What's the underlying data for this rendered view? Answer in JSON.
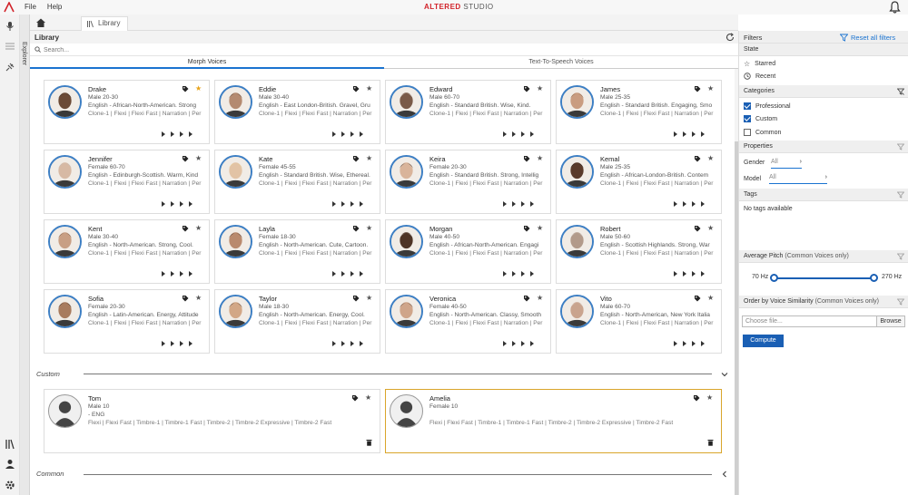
{
  "menu": {
    "file": "File",
    "help": "Help"
  },
  "brand": {
    "part1": "ALTERED",
    "part2": "STUDIO"
  },
  "explorer_label": "Explorer",
  "tabs": {
    "library": "Library"
  },
  "library": {
    "title": "Library",
    "search_placeholder": "Search...",
    "mode_tabs": [
      "Morph Voices",
      "Text-To-Speech Voices"
    ],
    "voices": [
      {
        "name": "Drake",
        "demo": "Male 20-30",
        "desc": "English - African-North-American. Strong",
        "types": "Clone-1 | Flexi | Flexi Fast | Narration | Per",
        "starred": true
      },
      {
        "name": "Eddie",
        "demo": "Male 30-40",
        "desc": "English - East London-British. Gravel, Gru",
        "types": "Clone-1 | Flexi | Flexi Fast | Narration | Per",
        "starred": false
      },
      {
        "name": "Edward",
        "demo": "Male 60-70",
        "desc": "English - Standard British. Wise, Kind.",
        "types": "Clone-1 | Flexi | Flexi Fast | Narration | Per",
        "starred": false
      },
      {
        "name": "James",
        "demo": "Male 25-35",
        "desc": "English - Standard British. Engaging, Smo",
        "types": "Clone-1 | Flexi | Flexi Fast | Narration | Per",
        "starred": false
      },
      {
        "name": "Jennifer",
        "demo": "Female 60-70",
        "desc": "English - Edinburgh-Scottish. Warm, Kind",
        "types": "Clone-1 | Flexi | Flexi Fast | Narration | Per",
        "starred": false
      },
      {
        "name": "Kate",
        "demo": "Female 45-55",
        "desc": "English - Standard British. Wise, Ethereal.",
        "types": "Clone-1 | Flexi | Flexi Fast | Narration | Per",
        "starred": false
      },
      {
        "name": "Keira",
        "demo": "Female 20-30",
        "desc": "English - Standard British. Strong, Intellig",
        "types": "Clone-1 | Flexi | Flexi Fast | Narration | Per",
        "starred": false
      },
      {
        "name": "Kemal",
        "demo": "Male 25-35",
        "desc": "English - African-London-British. Contem",
        "types": "Clone-1 | Flexi | Flexi Fast | Narration | Per",
        "starred": false
      },
      {
        "name": "Kent",
        "demo": "Male 30-40",
        "desc": "English - North-American. Strong, Cool.",
        "types": "Clone-1 | Flexi | Flexi Fast | Narration | Per",
        "starred": false
      },
      {
        "name": "Layla",
        "demo": "Female 18-30",
        "desc": "English - North-American. Cute, Cartoon.",
        "types": "Clone-1 | Flexi | Flexi Fast | Narration | Per",
        "starred": false
      },
      {
        "name": "Morgan",
        "demo": "Male 40-50",
        "desc": "English - African-North-American. Engagi",
        "types": "Clone-1 | Flexi | Flexi Fast | Narration | Per",
        "starred": false
      },
      {
        "name": "Robert",
        "demo": "Male 50-60",
        "desc": "English - Scottish Highlands. Strong, War",
        "types": "Clone-1 | Flexi | Flexi Fast | Narration | Per",
        "starred": false
      },
      {
        "name": "Sofia",
        "demo": "Female 20-30",
        "desc": "English - Latin-American. Energy, Attitude",
        "types": "Clone-1 | Flexi | Flexi Fast | Narration | Per",
        "starred": false
      },
      {
        "name": "Taylor",
        "demo": "Male 18-30",
        "desc": "English - North-American. Energy, Cool.",
        "types": "Clone-1 | Flexi | Flexi Fast | Narration | Per",
        "starred": false
      },
      {
        "name": "Veronica",
        "demo": "Female 40-50",
        "desc": "English - North-American. Classy, Smooth",
        "types": "Clone-1 | Flexi | Flexi Fast | Narration | Per",
        "starred": false
      },
      {
        "name": "Vito",
        "demo": "Male 60-70",
        "desc": "English - North-American, New York Italia",
        "types": "Clone-1 | Flexi | Flexi Fast | Narration | Per",
        "starred": false
      }
    ],
    "custom_section": "Custom",
    "custom_voices": [
      {
        "name": "Tom",
        "demo": "Male 10",
        "lang": "- ENG",
        "types": "Flexi | Flexi Fast | Timbre-1 | Timbre-1 Fast | Timbre-2 | Timbre-2 Expressive | Timbre-2 Fast"
      },
      {
        "name": "Amelia",
        "demo": "Female 10",
        "lang": "",
        "types": "Flexi | Flexi Fast | Timbre-1 | Timbre-1 Fast | Timbre-2 | Timbre-2 Expressive | Timbre-2 Fast"
      }
    ],
    "common_section": "Common"
  },
  "filters": {
    "title": "Filters",
    "reset": "Reset all filters",
    "state": {
      "label": "State",
      "starred": "Starred",
      "recent": "Recent"
    },
    "categories": {
      "label": "Categories",
      "professional": "Professional",
      "custom": "Custom",
      "common": "Common"
    },
    "properties": {
      "label": "Properties",
      "gender_label": "Gender",
      "gender_value": "All",
      "model_label": "Model",
      "model_value": "All"
    },
    "tags": {
      "label": "Tags",
      "empty": "No tags available"
    },
    "pitch": {
      "label": "Average Pitch",
      "sub": "(Common Voices only)",
      "min": "70 Hz",
      "max": "270 Hz"
    },
    "similarity": {
      "label": "Order by Voice Similarity",
      "sub": "(Common Voices only)",
      "file_placeholder": "Choose file...",
      "browse": "Browse",
      "compute": "Compute"
    }
  },
  "colors": {
    "accent": "#1a5fb4",
    "brand_red": "#d2232a",
    "star": "#e8a317",
    "selected_border": "#d9a52b"
  }
}
